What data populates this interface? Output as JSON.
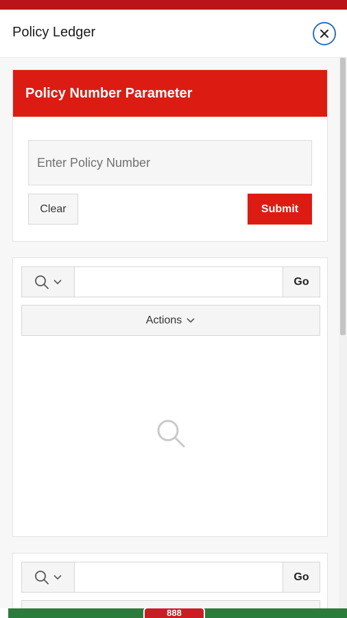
{
  "dialog": {
    "title": "Policy Ledger",
    "close_icon": "close-icon"
  },
  "parameter_card": {
    "title": "Policy Number Parameter",
    "policy_input": {
      "value": "",
      "placeholder": "Enter Policy Number"
    },
    "clear_label": "Clear",
    "submit_label": "Submit"
  },
  "report_1": {
    "search_scope_icon": "search-icon",
    "search_value": "",
    "go_label": "Go",
    "actions_label": "Actions",
    "empty_state_icon": "search-icon"
  },
  "report_2": {
    "search_scope_icon": "search-icon",
    "search_value": "",
    "go_label": "Go"
  },
  "bottom_badge": {
    "label": "888"
  },
  "colors": {
    "accent_red": "#dc1c13",
    "close_ring": "#2f6fb5",
    "bottom_bar": "#2b7b3c"
  }
}
